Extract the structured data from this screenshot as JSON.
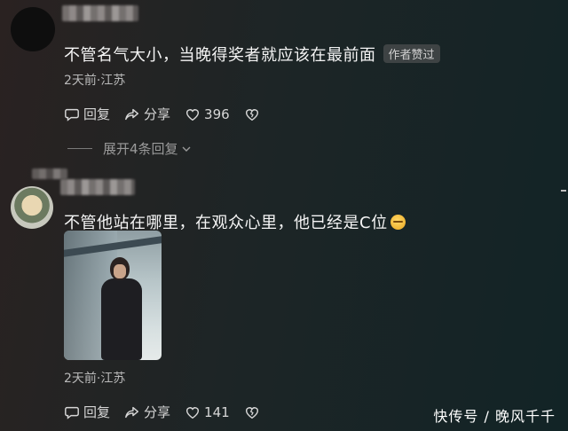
{
  "comments": [
    {
      "text": "不管名气大小，当晚得奖者就应该在最前面",
      "badge": "作者赞过",
      "meta": "2天前·江苏",
      "actions": {
        "reply": "回复",
        "share": "分享",
        "likes": "396"
      },
      "expand": "展开4条回复"
    },
    {
      "text": "不管他站在哪里，在观众心里，他已经是C位",
      "emoji": "smiling-face-emoji",
      "meta": "2天前·江苏",
      "actions": {
        "reply": "回复",
        "share": "分享",
        "likes": "141"
      }
    }
  ],
  "watermark": "快传号 / 晚风千千"
}
